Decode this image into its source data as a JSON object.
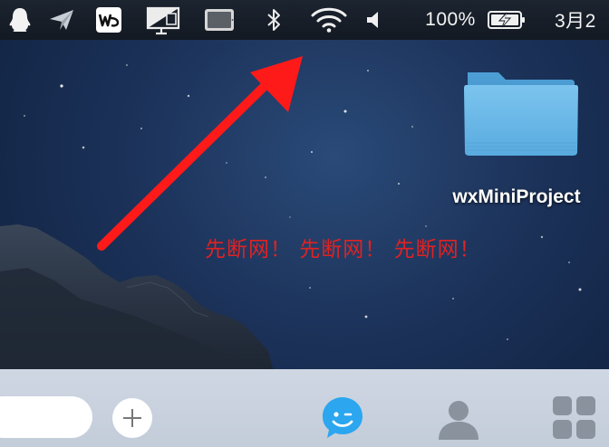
{
  "menubar": {
    "battery_percent": "100%",
    "date": "3月2",
    "icons": [
      "qq-icon",
      "send-icon",
      "wps-icon",
      "screen-mirror-icon",
      "tablet-icon",
      "bluetooth-icon",
      "wifi-icon",
      "volume-icon",
      "battery-charging-icon"
    ]
  },
  "desktop": {
    "folder_label": "wxMiniProject",
    "annotation_text": "先断网！ 先断网！ 先断网！",
    "annotation_color": "#e02222",
    "arrow_color": "#ff1a1a"
  },
  "bottombar": {
    "icons": [
      "add-icon",
      "chat-bubble-icon",
      "contacts-icon",
      "app-grid-icon"
    ],
    "accent_color": "#2ba6ef"
  }
}
